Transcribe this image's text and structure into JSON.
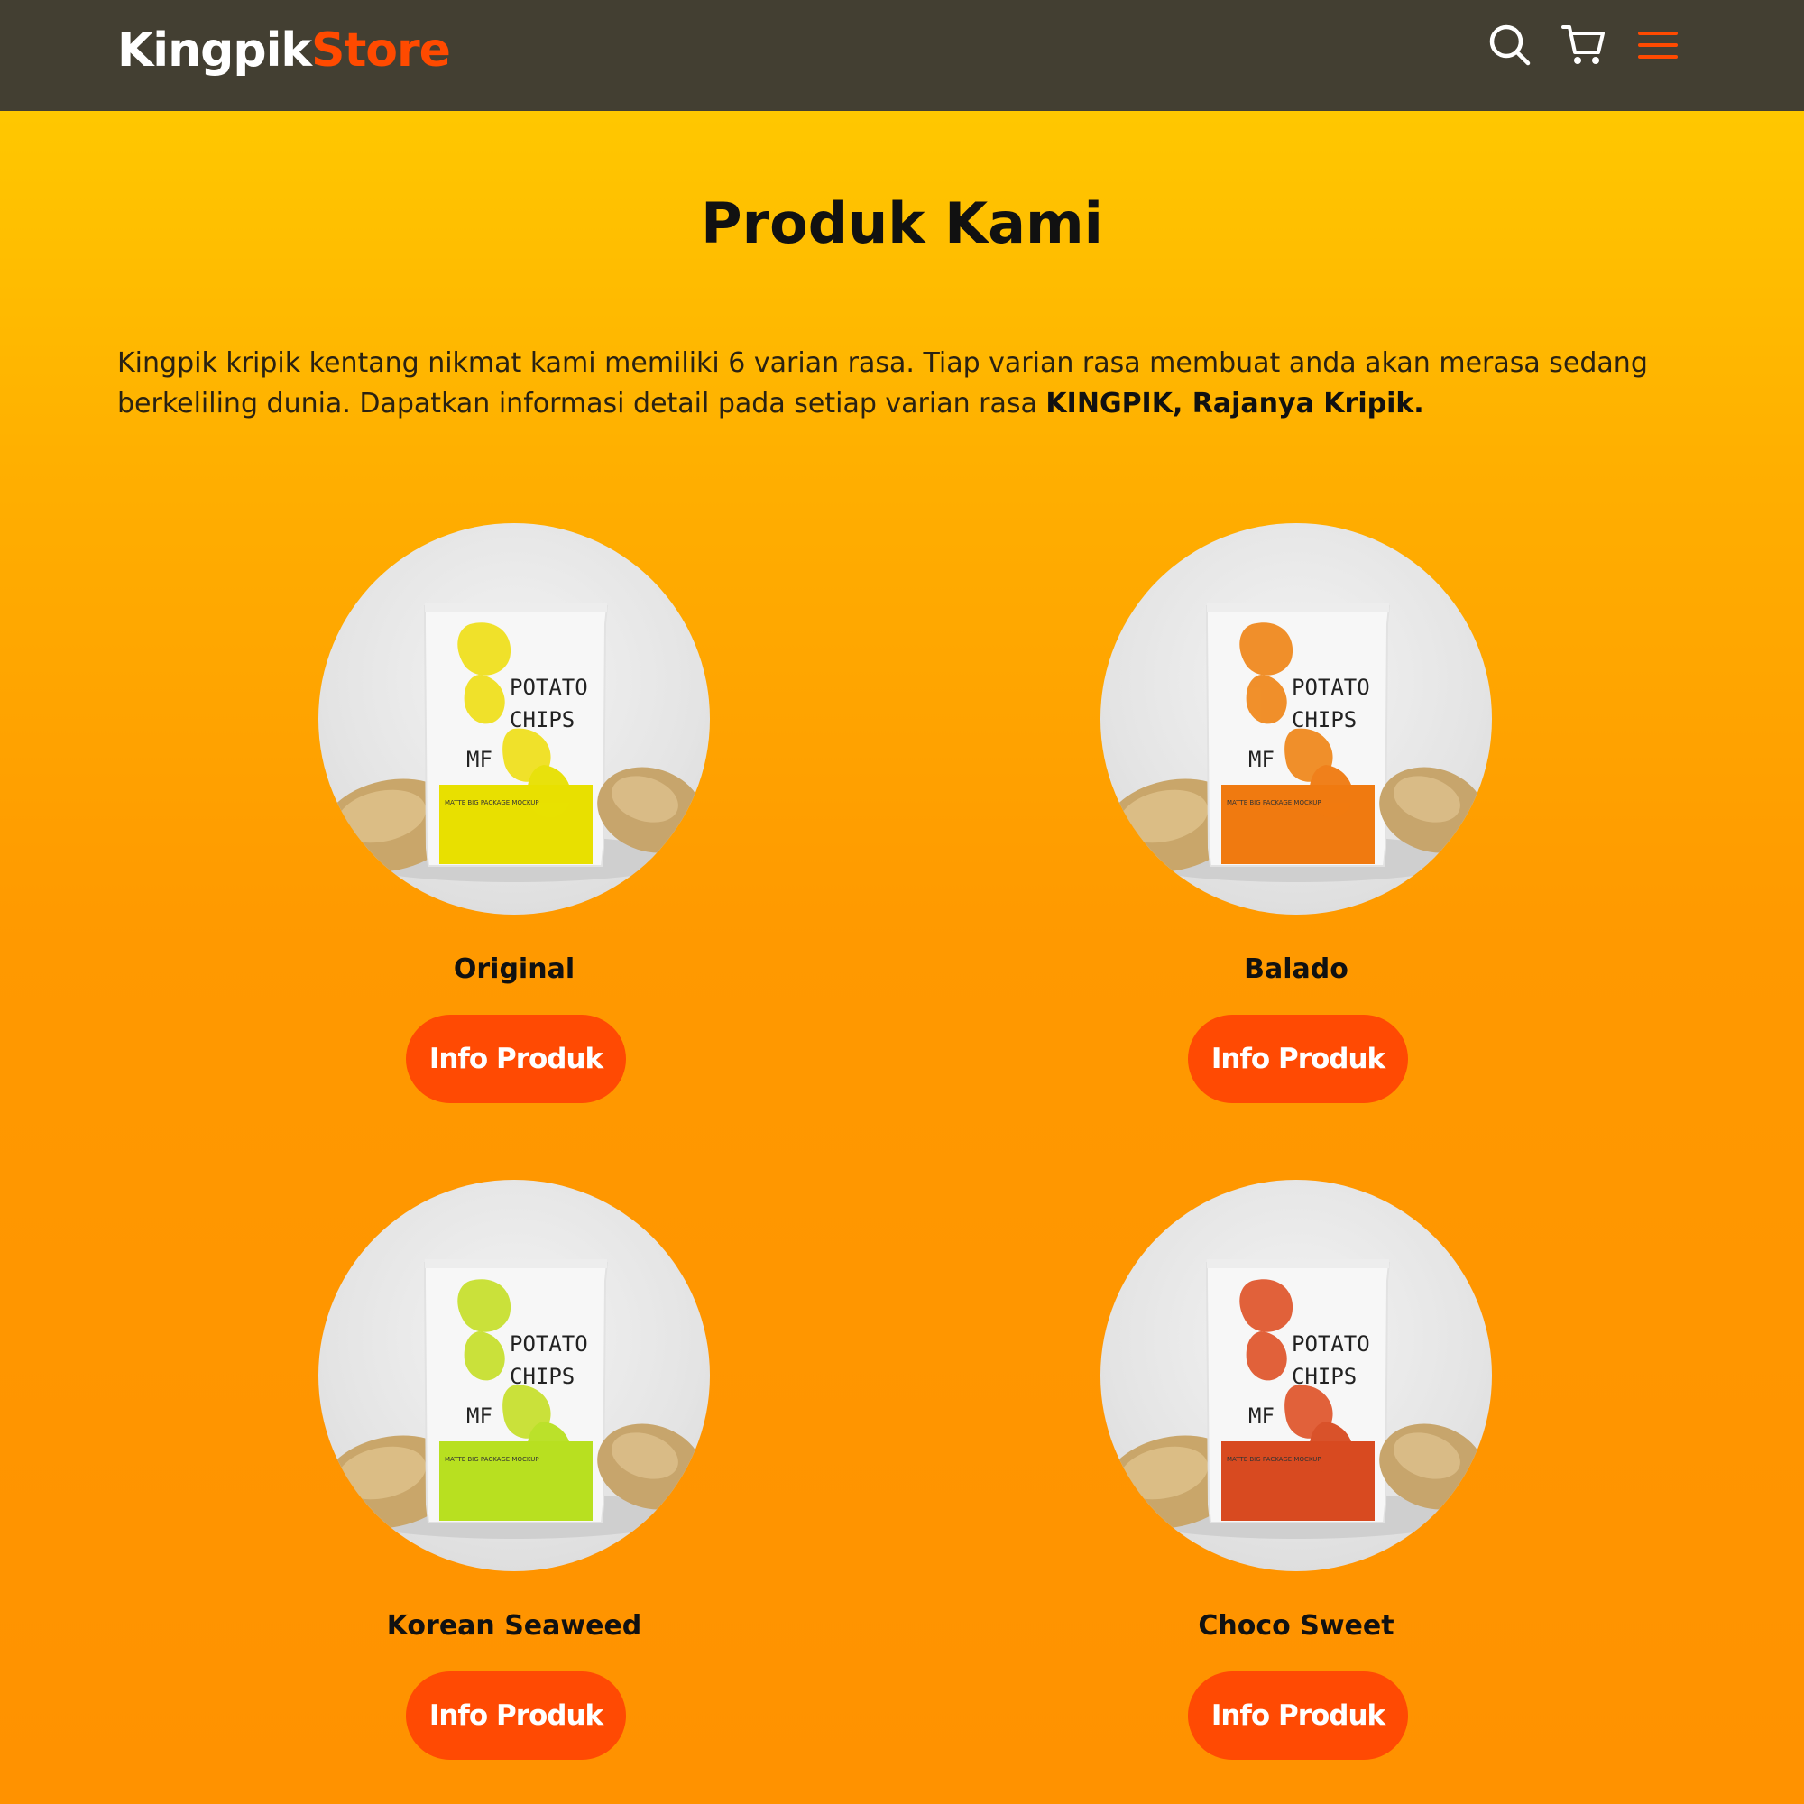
{
  "header": {
    "logo_part1": "Kingpik",
    "logo_part2": "Store",
    "icons": [
      "search-icon",
      "cart-icon",
      "menu-icon"
    ]
  },
  "section": {
    "title": "Produk Kami",
    "intro_text": "Kingpik kripik kentang nikmat kami memiliki 6 varian rasa. Tiap varian rasa membuat anda akan merasa sedang berkeliling dunia. Dapatkan informasi detail pada setiap varian rasa ",
    "intro_bold": "KINGPIK, Rajanya Kripik."
  },
  "products": [
    {
      "name": "Original",
      "button_label": "Info Produk",
      "accent_color": "#e8e000",
      "chip_color": "#f0e020"
    },
    {
      "name": "Balado",
      "button_label": "Info Produk",
      "accent_color": "#f07a10",
      "chip_color": "#f08a20"
    },
    {
      "name": "Korean Seaweed",
      "button_label": "Info Produk",
      "accent_color": "#b8e020",
      "chip_color": "#c8e030"
    },
    {
      "name": "Choco Sweet",
      "button_label": "Info Produk",
      "accent_color": "#d84a20",
      "chip_color": "#e05a30"
    }
  ],
  "package_text": {
    "line1": "POTATO",
    "line2": "CHIPS",
    "mark": "MF",
    "band_caption": "MATTE BIG PACKAGE MOCKUP"
  },
  "colors": {
    "navbar": "#433f32",
    "brand_orange": "#ff4a03",
    "gradient_top": "#ffcf00",
    "gradient_bottom": "#ff9200"
  }
}
